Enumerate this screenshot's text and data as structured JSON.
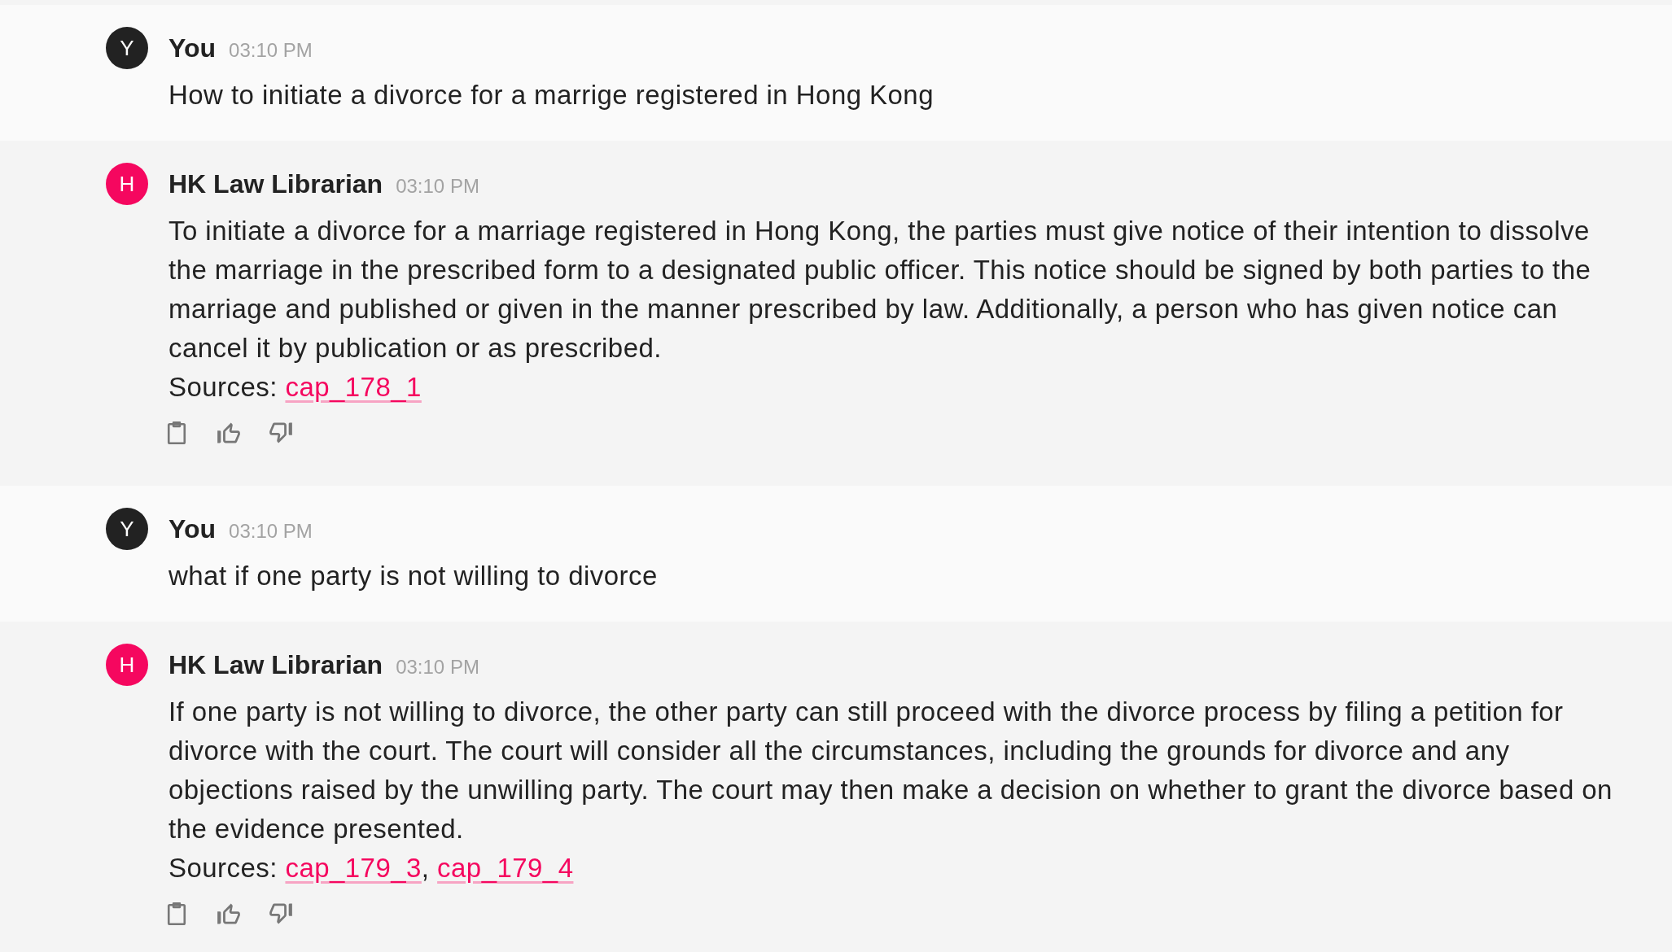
{
  "messages": [
    {
      "kind": "user",
      "avatar": "Y",
      "author": "You",
      "time": "03:10 PM",
      "text": "How to initiate a divorce for a marrige registered in Hong Kong"
    },
    {
      "kind": "bot",
      "avatar": "H",
      "author": "HK Law Librarian",
      "time": "03:10 PM",
      "text": "To initiate a divorce for a marriage registered in Hong Kong, the parties must give notice of their intention to dissolve the marriage in the prescribed form to a designated public officer. This notice should be signed by both parties to the marriage and published or given in the manner prescribed by law. Additionally, a person who has given notice can cancel it by publication or as prescribed.",
      "sources_label": "Sources:",
      "sources": [
        "cap_178_1"
      ]
    },
    {
      "kind": "user",
      "avatar": "Y",
      "author": "You",
      "time": "03:10 PM",
      "text": "what if one party is not willing to divorce"
    },
    {
      "kind": "bot",
      "avatar": "H",
      "author": "HK Law Librarian",
      "time": "03:10 PM",
      "text": "If one party is not willing to divorce, the other party can still proceed with the divorce process by filing a petition for divorce with the court. The court will consider all the circumstances, including the grounds for divorce and any objections raised by the unwilling party. The court may then make a decision on whether to grant the divorce based on the evidence presented.",
      "sources_label": "Sources:",
      "separator": ",",
      "sources": [
        "cap_179_3",
        "cap_179_4"
      ]
    }
  ]
}
